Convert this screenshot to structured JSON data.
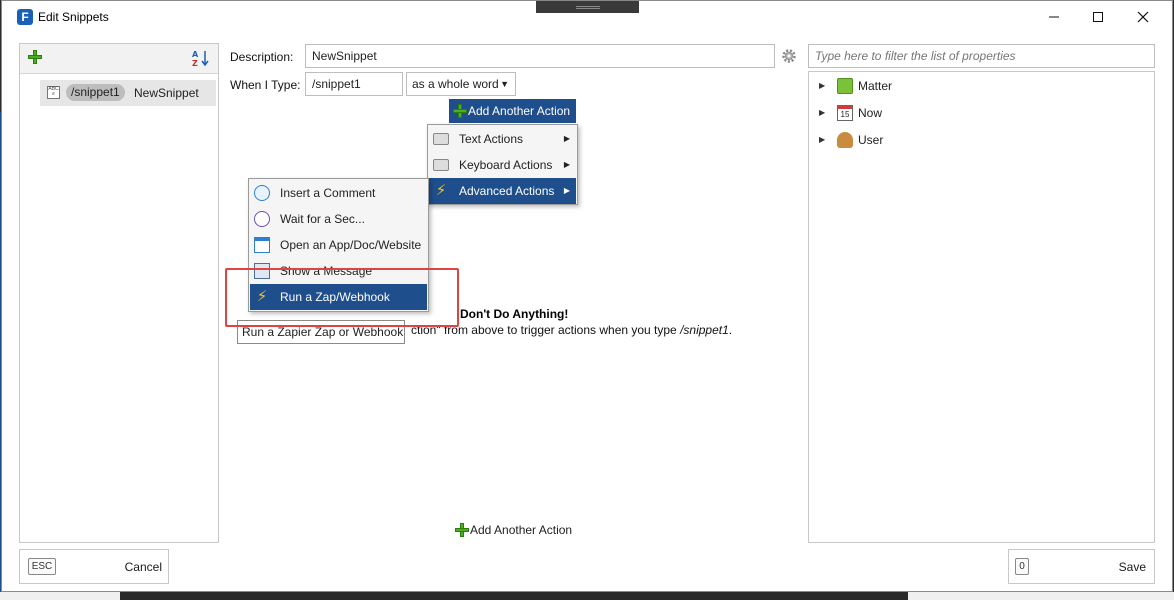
{
  "window": {
    "title": "Edit Snippets"
  },
  "left_panel": {
    "snippets": [
      {
        "abbreviation": "/snippet1",
        "name": "NewSnippet"
      }
    ]
  },
  "form": {
    "description_label": "Description:",
    "description_value": "NewSnippet",
    "when_label": "When I Type:",
    "when_value": "/snippet1",
    "match_mode": "as a whole word",
    "add_action_label": "Add Another Action"
  },
  "menu_main": {
    "items": [
      {
        "label": "Text Actions",
        "icon": "keyboard-icon"
      },
      {
        "label": "Keyboard Actions",
        "icon": "keyboard-icon"
      },
      {
        "label": "Advanced Actions",
        "icon": "lightning-icon",
        "selected": true
      }
    ]
  },
  "menu_advanced": {
    "items": [
      {
        "label": "Insert a Comment",
        "icon": "comment-icon"
      },
      {
        "label": "Wait for a Sec...",
        "icon": "clock-icon"
      },
      {
        "label": "Open an App/Doc/Website",
        "icon": "window-icon"
      },
      {
        "label": "Show a Message",
        "icon": "message-icon"
      },
      {
        "label": "Run a Zap/Webhook",
        "icon": "lightning-icon",
        "selected": true
      }
    ]
  },
  "tooltip": "Run a Zapier Zap or Webhook",
  "empty_message": {
    "title": "Don't Do Anything!",
    "body_prefix": "ction\" from above to trigger actions when you type ",
    "body_snippet": "/snippet1",
    "body_suffix": "."
  },
  "properties": {
    "filter_placeholder": "Type here to filter the list of properties",
    "items": [
      {
        "label": "Matter",
        "icon": "folder-icon"
      },
      {
        "label": "Now",
        "icon": "calendar-icon"
      },
      {
        "label": "User",
        "icon": "user-icon"
      }
    ]
  },
  "footer": {
    "cancel_key": "ESC",
    "cancel_label": "Cancel",
    "save_key": "0",
    "save_label": "Save"
  },
  "colors": {
    "selection": "#1f4e8c",
    "highlight_box": "#e04343",
    "plus_green": "#4caf20"
  }
}
